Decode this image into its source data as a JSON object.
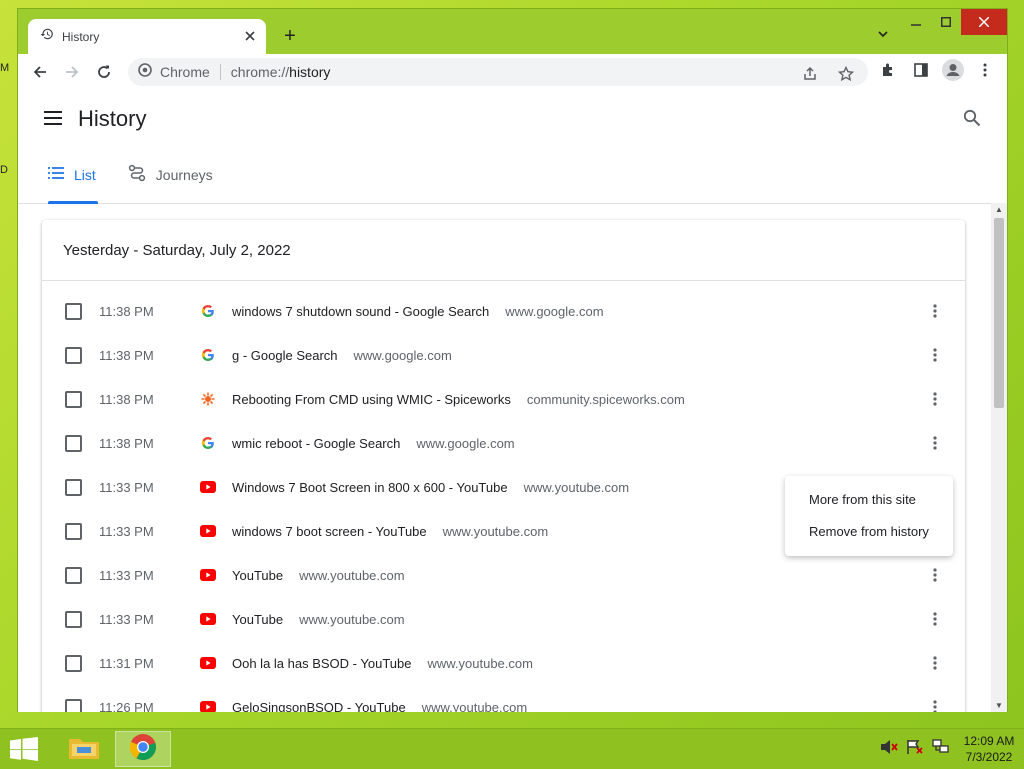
{
  "browser": {
    "tab_title": "History",
    "new_tab_symbol": "+",
    "omnibox_site": "Chrome",
    "omnibox_url_scheme": "chrome://",
    "omnibox_url_path": "history"
  },
  "page": {
    "title": "History",
    "tabs": [
      {
        "label": "List",
        "active": true
      },
      {
        "label": "Journeys",
        "active": false
      }
    ],
    "date_header": "Yesterday - Saturday, July 2, 2022"
  },
  "history_items": [
    {
      "time": "11:38 PM",
      "favicon": "google-icon",
      "title": "windows 7 shutdown sound - Google Search",
      "domain": "www.google.com"
    },
    {
      "time": "11:38 PM",
      "favicon": "google-icon",
      "title": "g - Google Search",
      "domain": "www.google.com"
    },
    {
      "time": "11:38 PM",
      "favicon": "spiceworks-icon",
      "title": "Rebooting From CMD using WMIC - Spiceworks",
      "domain": "community.spiceworks.com"
    },
    {
      "time": "11:38 PM",
      "favicon": "google-icon",
      "title": "wmic reboot - Google Search",
      "domain": "www.google.com"
    },
    {
      "time": "11:33 PM",
      "favicon": "youtube-icon",
      "title": "Windows 7 Boot Screen in 800 x 600 - YouTube",
      "domain": "www.youtube.com"
    },
    {
      "time": "11:33 PM",
      "favicon": "youtube-icon",
      "title": "windows 7 boot screen - YouTube",
      "domain": "www.youtube.com"
    },
    {
      "time": "11:33 PM",
      "favicon": "youtube-icon",
      "title": "YouTube",
      "domain": "www.youtube.com"
    },
    {
      "time": "11:33 PM",
      "favicon": "youtube-icon",
      "title": "YouTube",
      "domain": "www.youtube.com"
    },
    {
      "time": "11:31 PM",
      "favicon": "youtube-icon",
      "title": "Ooh la la has BSOD - YouTube",
      "domain": "www.youtube.com"
    },
    {
      "time": "11:26 PM",
      "favicon": "youtube-icon",
      "title": "GeloSingsonBSOD - YouTube",
      "domain": "www.youtube.com"
    }
  ],
  "context_menu": {
    "more_from_site": "More from this site",
    "remove_from_history": "Remove from history"
  },
  "taskbar": {
    "time": "12:09 AM",
    "date": "7/3/2022"
  },
  "colors": {
    "accent": "#1a73e8",
    "desktop": "#a8d62a",
    "close_button": "#c42b1c"
  }
}
